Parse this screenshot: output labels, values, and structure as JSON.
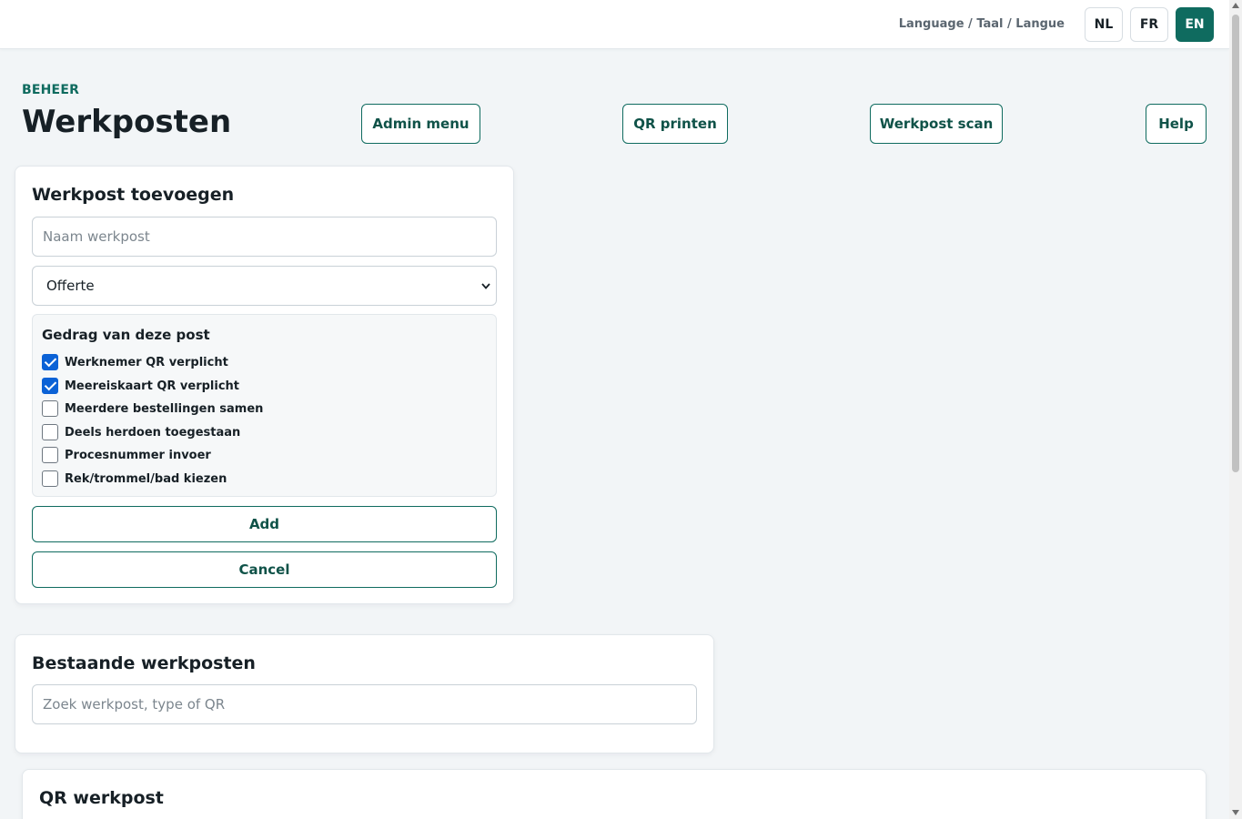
{
  "topbar": {
    "language_label": "Language / Taal / Langue",
    "languages": [
      {
        "code": "NL",
        "active": false
      },
      {
        "code": "FR",
        "active": false
      },
      {
        "code": "EN",
        "active": true
      }
    ]
  },
  "header": {
    "eyebrow": "BEHEER",
    "title": "Werkposten",
    "buttons": {
      "admin_menu": "Admin menu",
      "qr_print": "QR printen",
      "workpost_scan": "Werkpost scan",
      "help": "Help"
    }
  },
  "add_card": {
    "title": "Werkpost toevoegen",
    "name_placeholder": "Naam werkpost",
    "name_value": "",
    "type_selected": "Offerte",
    "behavior": {
      "title": "Gedrag van deze post",
      "options": [
        {
          "label": "Werknemer QR verplicht",
          "checked": true
        },
        {
          "label": "Meereiskaart QR verplicht",
          "checked": true
        },
        {
          "label": "Meerdere bestellingen samen",
          "checked": false
        },
        {
          "label": "Deels herdoen toegestaan",
          "checked": false
        },
        {
          "label": "Procesnummer invoer",
          "checked": false
        },
        {
          "label": "Rek/trommel/bad kiezen",
          "checked": false
        }
      ]
    },
    "add_label": "Add",
    "cancel_label": "Cancel"
  },
  "existing_card": {
    "title": "Bestaande werkposten",
    "search_placeholder": "Zoek werkpost, type of QR"
  },
  "qr_card": {
    "title": "QR werkpost"
  },
  "colors": {
    "accent": "#0f6b5f",
    "checkbox_checked": "#0b62d6",
    "background": "#f2f5f7"
  }
}
